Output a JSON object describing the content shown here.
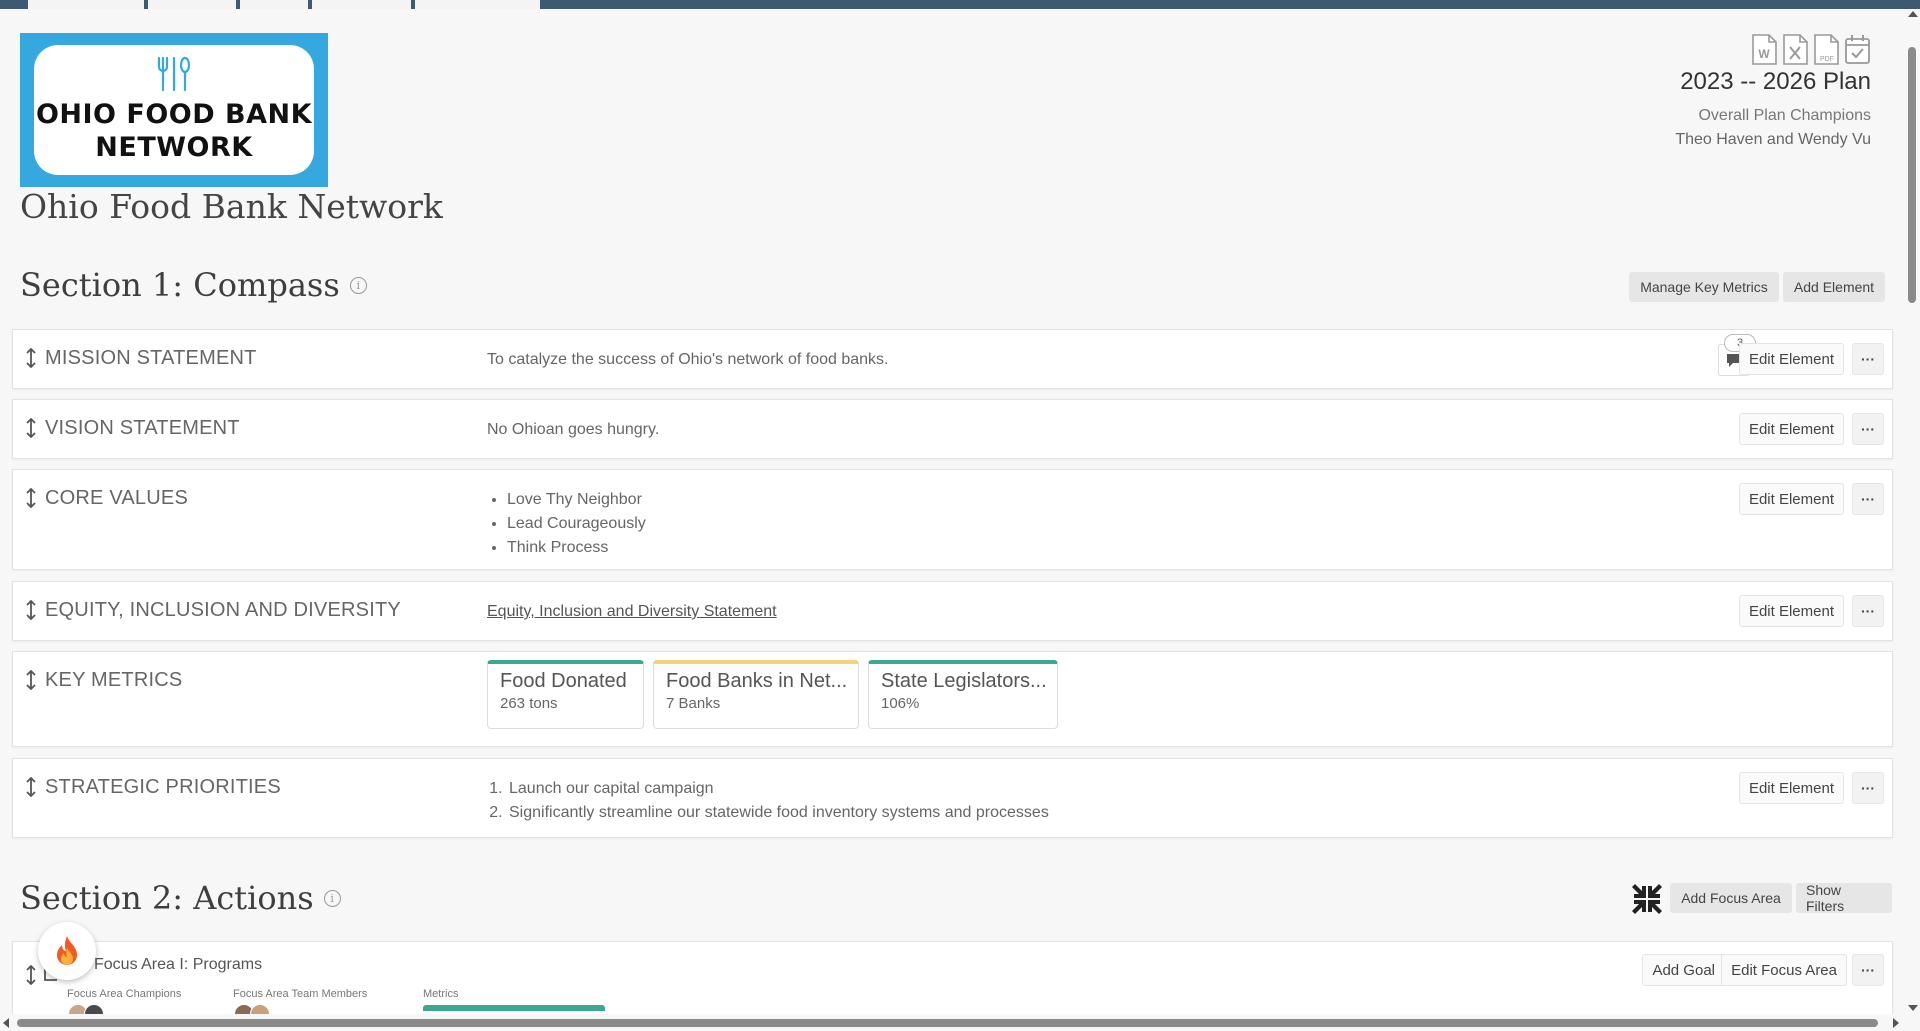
{
  "header": {
    "logo_text_line1": "OHIO FOOD BANK",
    "logo_text_line2": "NETWORK",
    "org_name": "Ohio Food Bank Network",
    "plan_title": "2023 -- 2026 Plan",
    "champions_label": "Overall Plan Champions",
    "champions_names": "Theo Haven and Wendy Vu",
    "export_icons": [
      "word-export-icon",
      "excel-export-icon",
      "pdf-export-icon",
      "calendar-check-icon"
    ]
  },
  "section1": {
    "title": "Section 1: Compass",
    "manage_metrics_label": "Manage Key Metrics",
    "add_element_label": "Add Element",
    "mission": {
      "label": "MISSION STATEMENT",
      "text": "To catalyze the success of Ohio's network of food banks.",
      "comment_count": "3",
      "edit_label": "Edit Element"
    },
    "vision": {
      "label": "VISION STATEMENT",
      "text": "No Ohioan goes hungry.",
      "edit_label": "Edit Element"
    },
    "core_values": {
      "label": "CORE VALUES",
      "items": [
        "Love Thy Neighbor",
        "Lead Courageously",
        "Think Process"
      ],
      "edit_label": "Edit Element"
    },
    "equity": {
      "label": "EQUITY, INCLUSION AND DIVERSITY",
      "link_text": "Equity, Inclusion and Diversity Statement",
      "edit_label": "Edit Element"
    },
    "key_metrics": {
      "label": "KEY METRICS",
      "cards": [
        {
          "name": "Food Donated",
          "value": "263 tons",
          "status_color": "#3ba88f"
        },
        {
          "name": "Food Banks in Net...",
          "value": "7 Banks",
          "status_color": "#f2d27a"
        },
        {
          "name": "State Legislators...",
          "value": "106%",
          "status_color": "#3ba88f"
        }
      ]
    },
    "priorities": {
      "label": "STRATEGIC PRIORITIES",
      "items": [
        "Launch our capital campaign",
        "Significantly streamline our statewide food inventory systems and processes"
      ],
      "edit_label": "Edit Element"
    }
  },
  "section2": {
    "title": "Section 2: Actions",
    "add_focus_area_label": "Add Focus Area",
    "show_filters_label": "Show Filters",
    "focus_area": {
      "title": "Focus Area I: Programs",
      "champions_label": "Focus Area Champions",
      "team_label": "Focus Area Team Members",
      "metrics_label": "Metrics",
      "add_goal_label": "Add Goal",
      "edit_label": "Edit Focus Area"
    }
  },
  "more_label": "···",
  "colors": {
    "logo_blue": "#35a9df",
    "topbar": "#3d5a73",
    "metric_green": "#3ba88f",
    "metric_yellow": "#f2d27a"
  }
}
